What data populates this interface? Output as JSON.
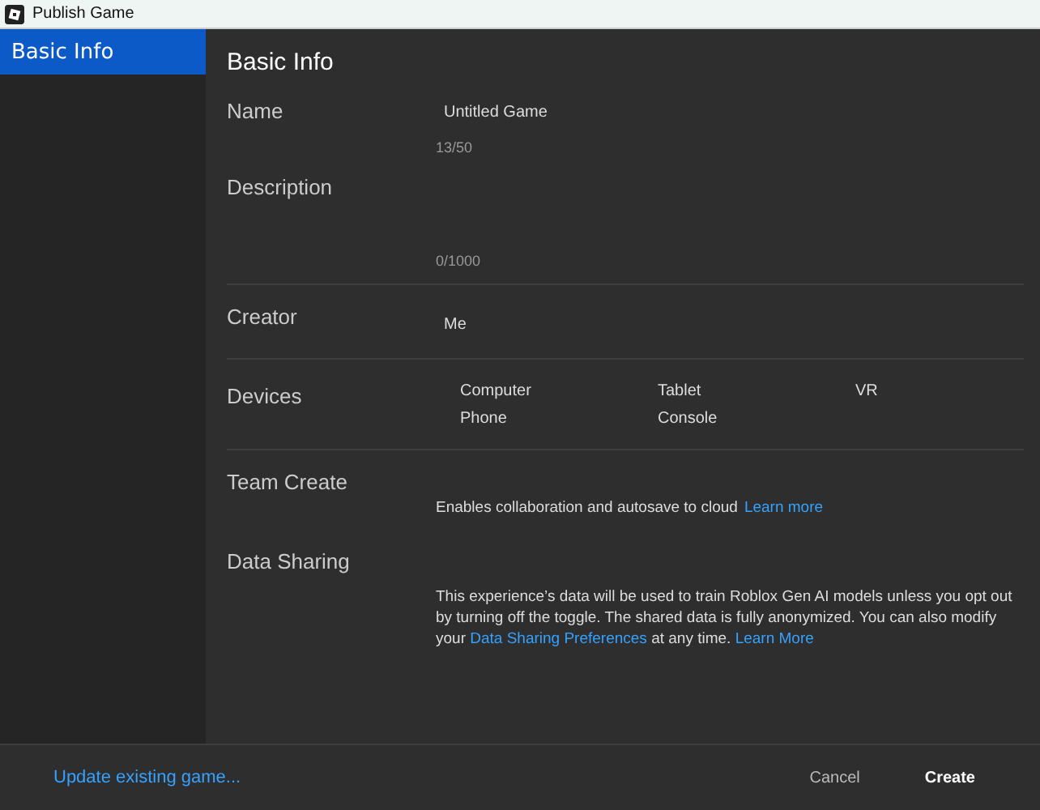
{
  "window": {
    "title": "Publish Game"
  },
  "sidebar": {
    "items": [
      {
        "label": "Basic Info",
        "selected": true
      }
    ]
  },
  "heading": "Basic Info",
  "name": {
    "label": "Name",
    "value": "Untitled Game",
    "count": "13/50"
  },
  "description": {
    "label": "Description",
    "count": "0/1000"
  },
  "creator": {
    "label": "Creator",
    "value": "Me"
  },
  "devices": {
    "label": "Devices",
    "items": [
      "Computer",
      "Tablet",
      "VR",
      "Phone",
      "Console"
    ]
  },
  "team_create": {
    "label": "Team Create",
    "text": "Enables collaboration and autosave to cloud",
    "link": "Learn more"
  },
  "data_sharing": {
    "label": "Data Sharing",
    "parts": [
      {
        "kind": "text",
        "text": "This experience’s data will be used to train Roblox Gen AI models unless you opt out by turning off the toggle. The shared data is fully anonymized. You can also modify your "
      },
      {
        "kind": "link",
        "text": "Data Sharing Preferences"
      },
      {
        "kind": "text",
        "text": " at any time. "
      },
      {
        "kind": "link",
        "text": "Learn More"
      }
    ]
  },
  "footer": {
    "update_link": "Update existing game...",
    "cancel": "Cancel",
    "create": "Create"
  }
}
